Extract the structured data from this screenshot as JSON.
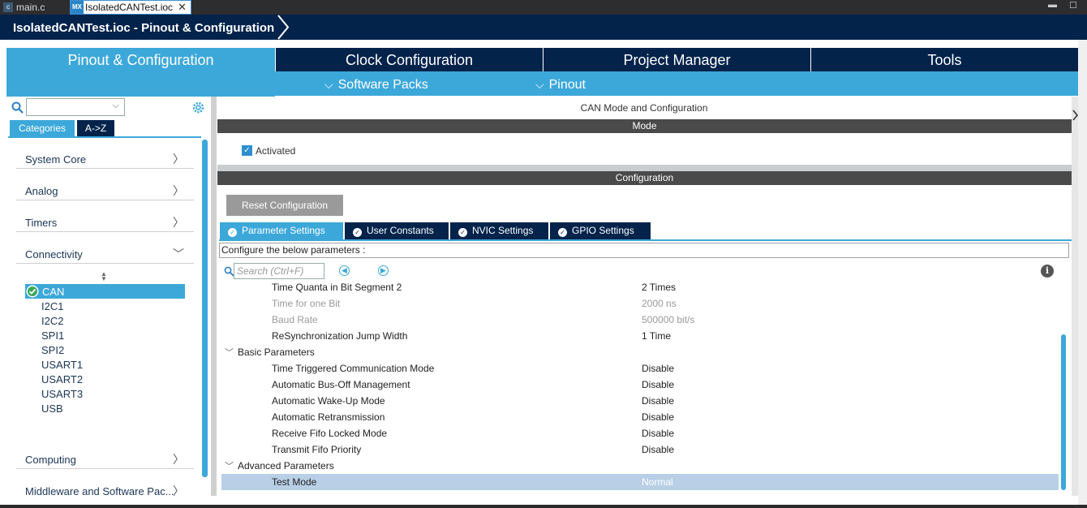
{
  "editor_tabs": [
    {
      "label": "main.c",
      "icon": "c-file-icon"
    },
    {
      "label": "IsolatedCANTest.ioc",
      "icon": "mx-icon",
      "icon_text": "MX"
    }
  ],
  "breadcrumb": "IsolatedCANTest.ioc - Pinout & Configuration",
  "top_tabs": [
    "Pinout & Configuration",
    "Clock Configuration",
    "Project Manager",
    "Tools"
  ],
  "sub_menu": [
    "Software Packs",
    "Pinout"
  ],
  "left": {
    "tabs": [
      "Categories",
      "A->Z"
    ],
    "categories": [
      "System Core",
      "Analog",
      "Timers",
      "Connectivity",
      "Computing",
      "Middleware and Software Pac..."
    ],
    "connectivity_items": [
      "CAN",
      "I2C1",
      "I2C2",
      "SPI1",
      "SPI2",
      "USART1",
      "USART2",
      "USART3",
      "USB"
    ]
  },
  "right": {
    "title": "CAN Mode and Configuration",
    "mode_header": "Mode",
    "activated_label": "Activated",
    "config_header": "Configuration",
    "reset_button": "Reset Configuration",
    "param_tabs": [
      "Parameter Settings",
      "User Constants",
      "NVIC Settings",
      "GPIO Settings"
    ],
    "configure_label": "Configure the below parameters :",
    "search_placeholder": "Search (Ctrl+F)",
    "rows": [
      {
        "name": "Time Quanta in Bit Segment 2",
        "value": "2 Times"
      },
      {
        "name": "Time for one Bit",
        "value": "2000 ns"
      },
      {
        "name": "Baud Rate",
        "value": "500000 bit/s"
      },
      {
        "name": "ReSynchronization Jump Width",
        "value": "1 Time"
      },
      {
        "name": "Basic Parameters",
        "value": ""
      },
      {
        "name": "Time Triggered Communication Mode",
        "value": "Disable"
      },
      {
        "name": "Automatic Bus-Off Management",
        "value": "Disable"
      },
      {
        "name": "Automatic Wake-Up Mode",
        "value": "Disable"
      },
      {
        "name": "Automatic Retransmission",
        "value": "Disable"
      },
      {
        "name": "Receive Fifo Locked Mode",
        "value": "Disable"
      },
      {
        "name": "Transmit Fifo Priority",
        "value": "Disable"
      },
      {
        "name": "Advanced Parameters",
        "value": ""
      },
      {
        "name": "Test Mode",
        "value": "Normal"
      }
    ]
  },
  "colors": {
    "navy": "#03234b",
    "accent": "#3ca8da",
    "header_gray": "#4a4a4a"
  }
}
